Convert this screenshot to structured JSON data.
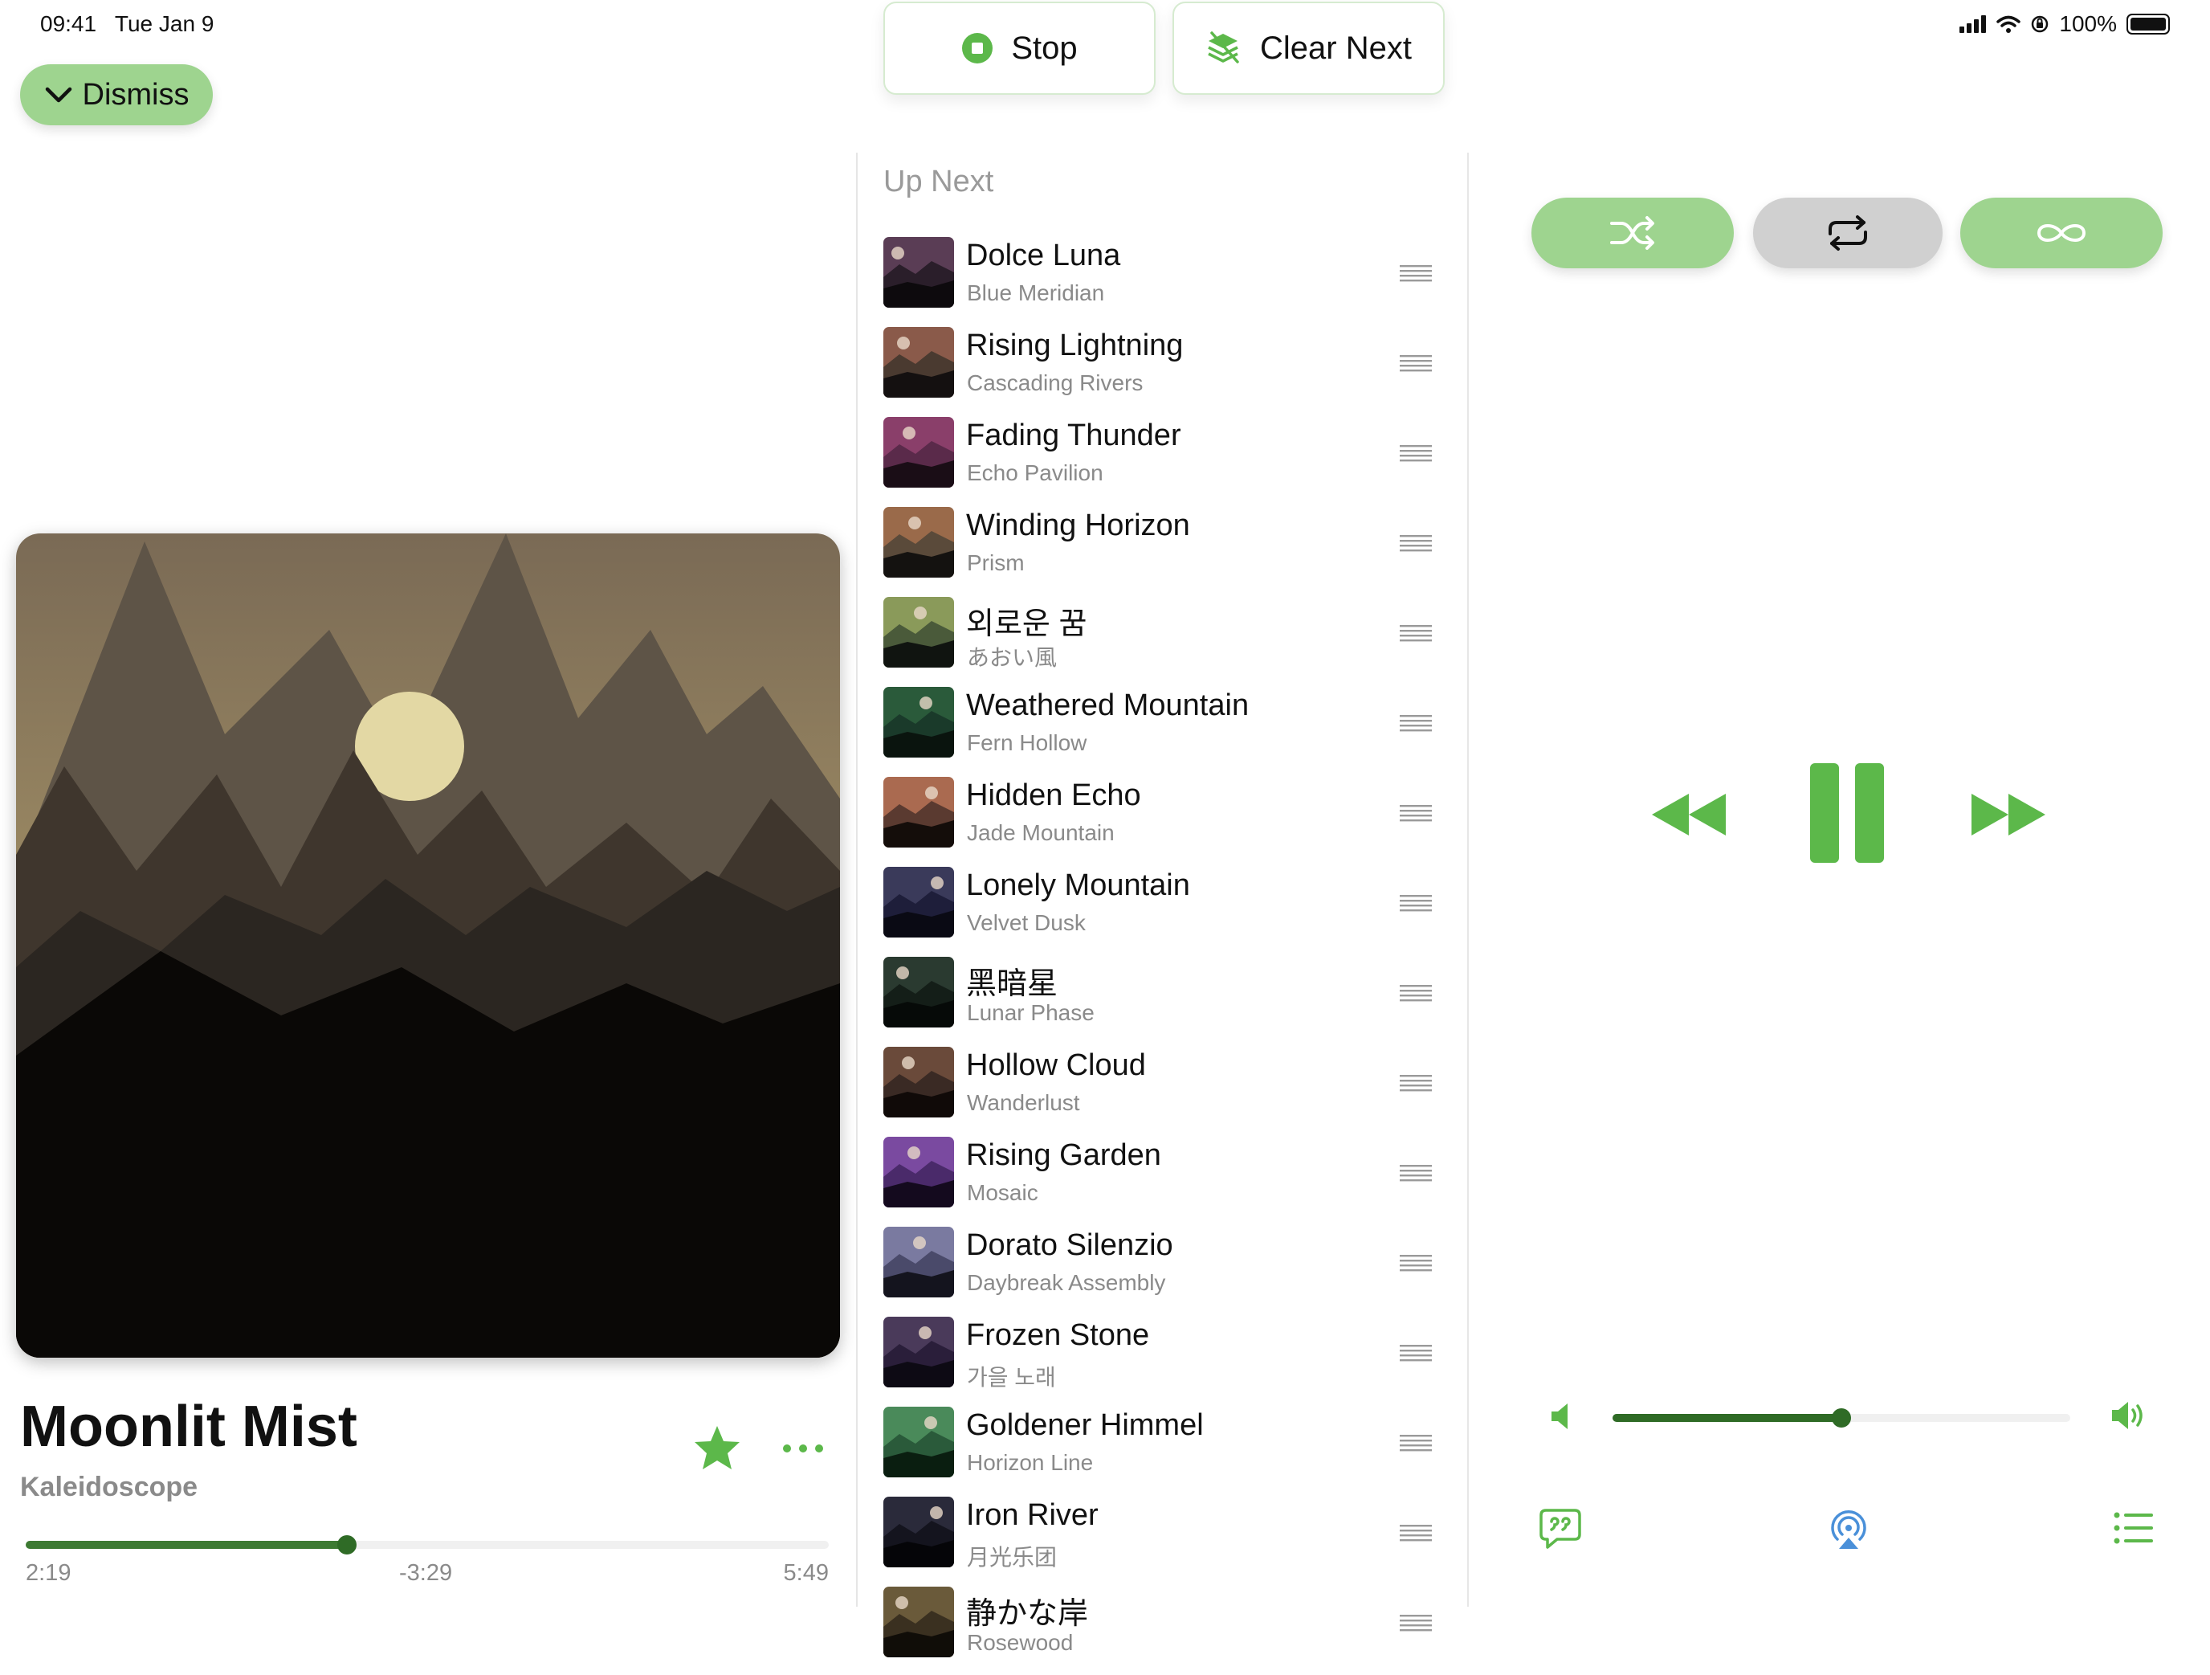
{
  "status_bar": {
    "time": "09:41",
    "date": "Tue Jan 9",
    "battery": "100%",
    "icons": [
      "signal-icon",
      "wifi-icon",
      "orientation-lock-icon",
      "battery-icon"
    ]
  },
  "dismiss": {
    "label": "Dismiss",
    "icon": "chevron-down-icon"
  },
  "controls": {
    "stop_label": "Stop",
    "clear_next_label": "Clear Next"
  },
  "now_playing": {
    "title": "Moonlit Mist",
    "artist": "Kaleidoscope",
    "elapsed": "2:19",
    "remaining": "-3:29",
    "duration": "5:49",
    "progress": 0.4
  },
  "up_next": {
    "heading": "Up Next",
    "tracks": [
      {
        "title": "Dolce Luna",
        "artist": "Blue Meridian"
      },
      {
        "title": "Rising Lightning",
        "artist": "Cascading Rivers"
      },
      {
        "title": "Fading Thunder",
        "artist": "Echo Pavilion"
      },
      {
        "title": "Winding Horizon",
        "artist": "Prism"
      },
      {
        "title": "외로운 꿈",
        "artist": "あおい風"
      },
      {
        "title": "Weathered Mountain",
        "artist": "Fern Hollow"
      },
      {
        "title": "Hidden Echo",
        "artist": "Jade Mountain"
      },
      {
        "title": "Lonely Mountain",
        "artist": "Velvet Dusk"
      },
      {
        "title": "黑暗星",
        "artist": "Lunar Phase"
      },
      {
        "title": "Hollow Cloud",
        "artist": "Wanderlust"
      },
      {
        "title": "Rising Garden",
        "artist": "Mosaic"
      },
      {
        "title": "Dorato Silenzio",
        "artist": "Daybreak Assembly"
      },
      {
        "title": "Frozen Stone",
        "artist": "가을 노래"
      },
      {
        "title": "Goldener Himmel",
        "artist": "Horizon Line"
      },
      {
        "title": "Iron River",
        "artist": "月光乐团"
      },
      {
        "title": "静かな岸",
        "artist": "Rosewood"
      }
    ]
  },
  "playback": {
    "shuffle_on": true,
    "repeat_on": false,
    "infinite_on": true,
    "volume": 0.5,
    "accent": "#5cb84a"
  }
}
